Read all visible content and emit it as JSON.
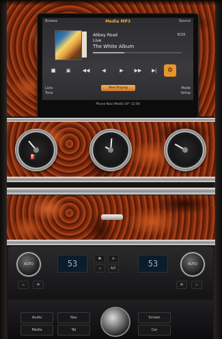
{
  "screen": {
    "top_left": "Browse",
    "title": "Media MP3",
    "top_right": "Source",
    "bottom_left": "Lists",
    "bottom_left_2": "Tone",
    "bottom_right": "Mode",
    "bottom_right_2": "Setup",
    "now_playing_button": "Now Playing",
    "status_bar": "Phone   Navi   Media   19°   12:00"
  },
  "track": {
    "title": "Abbey Road",
    "artist": "Live",
    "album": "The White Album",
    "number": "6/19",
    "progress": 0.35
  },
  "controls": [
    {
      "name": "stop",
      "glyph": "■"
    },
    {
      "name": "repeat",
      "glyph": "▣"
    },
    {
      "name": "prev",
      "glyph": "◀◀"
    },
    {
      "name": "rewind",
      "glyph": "◀"
    },
    {
      "name": "play",
      "glyph": "▶"
    },
    {
      "name": "forward",
      "glyph": "▶▶"
    },
    {
      "name": "next",
      "glyph": "▶|"
    },
    {
      "name": "options",
      "glyph": "⚙",
      "active": true
    }
  ],
  "climate": {
    "left_temp": "53",
    "right_temp": "53",
    "left_knob": "AUTO",
    "right_knob": "AUTO",
    "ac_label": "A/C"
  },
  "lower_buttons": {
    "audio": "Audio",
    "media": "Media",
    "nav": "Nav",
    "screen": "Screen",
    "tel": "Tel",
    "car": "Car"
  },
  "icons": [
    "fuel-gauge-icon",
    "clock-icon",
    "temperature-gauge-icon"
  ],
  "colors": {
    "accent": "#e8962a",
    "screen_bg": "#2b2b30",
    "lcd_text": "#8fb8d8"
  }
}
